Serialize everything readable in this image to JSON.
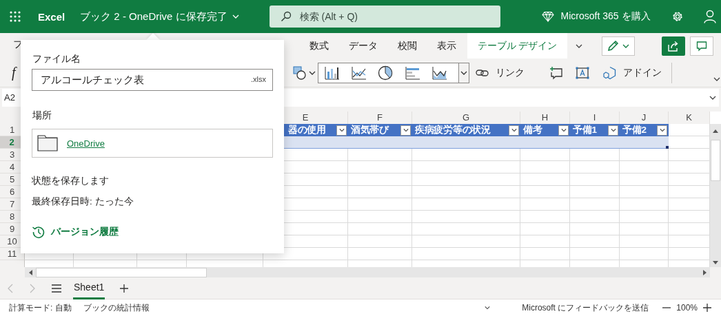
{
  "app_bar": {
    "app_name": "Excel",
    "document_title": "ブック 2 - OneDrive に保存完了",
    "search": {
      "placeholder": "検索 (Alt + Q)"
    },
    "buy_label": "Microsoft 365 を購入"
  },
  "ribbon": {
    "cut_tab": "フ",
    "tabs": [
      {
        "label": "数式",
        "selected": false
      },
      {
        "label": "データ",
        "selected": false
      },
      {
        "label": "校閲",
        "selected": false
      },
      {
        "label": "表示",
        "selected": false
      },
      {
        "label": "テーブル デザイン",
        "selected": true
      }
    ],
    "function_label": "f",
    "link_label": "リンク",
    "addin_label": "アドイン"
  },
  "formula_bar": {
    "name_box": "A2"
  },
  "sheet": {
    "columns": [
      "E",
      "F",
      "G",
      "H",
      "I",
      "J",
      "K"
    ],
    "row_numbers": [
      {
        "label": "1",
        "selected": false
      },
      {
        "label": "2",
        "selected": true
      },
      {
        "label": "3",
        "selected": false
      },
      {
        "label": "4",
        "selected": false
      },
      {
        "label": "5",
        "selected": false
      },
      {
        "label": "6",
        "selected": false
      },
      {
        "label": "7",
        "selected": false
      },
      {
        "label": "8",
        "selected": false
      },
      {
        "label": "9",
        "selected": false
      },
      {
        "label": "10",
        "selected": false
      },
      {
        "label": "11",
        "selected": false
      }
    ],
    "table_headers": [
      "器の使用",
      "酒気帯び",
      "疾病疲労等の状況",
      "備考",
      "予備1",
      "予備2"
    ]
  },
  "sheet_tabs": [
    {
      "label": "Sheet1",
      "selected": true
    }
  ],
  "status_bar": {
    "calc_mode": "計算モード: 自動",
    "stats": "ブックの統計情報",
    "feedback": "Microsoft にフィードバックを送信",
    "zoom": "100%"
  },
  "save_popup": {
    "file_name_label": "ファイル名",
    "file_name": "アルコールチェック表",
    "extension": ".xlsx",
    "location_label": "場所",
    "location": "OneDrive",
    "status": "状態を保存します",
    "last_saved": "最終保存日時: たった今",
    "version_history": "バージョン履歴"
  }
}
